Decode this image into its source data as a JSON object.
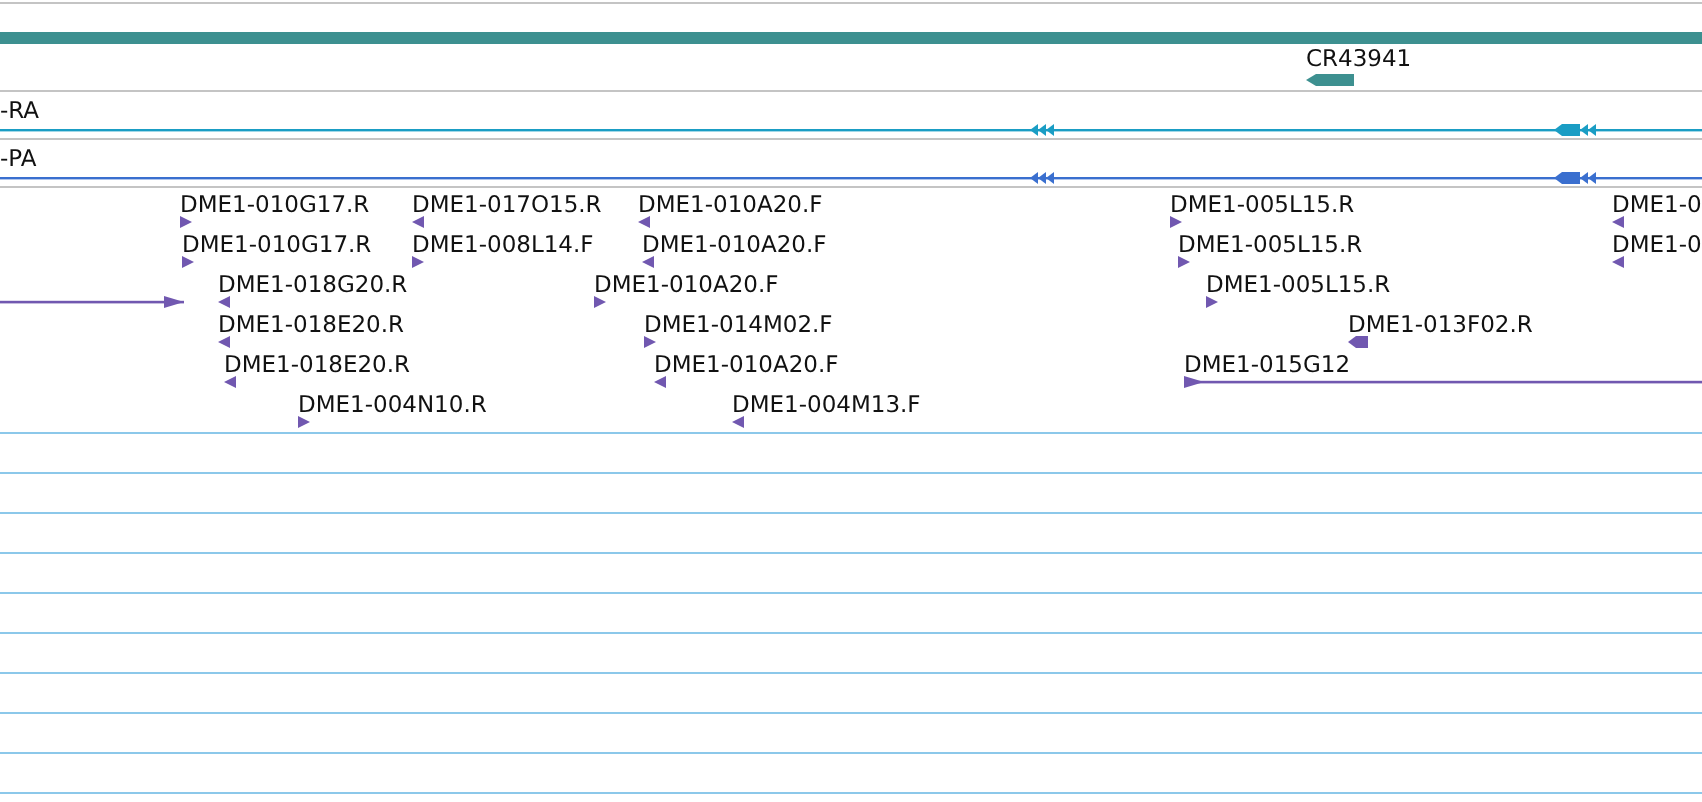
{
  "gene_track": {
    "features": [
      {
        "label": "CR43941",
        "reverse": true
      }
    ]
  },
  "transcript_track": {
    "label": "-RA",
    "reverse": true
  },
  "protein_track": {
    "label": "-PA",
    "reverse": true
  },
  "clone_track": {
    "features": [
      {
        "kind": "marker",
        "label": "DME1-010G17.R",
        "reverse": false
      },
      {
        "kind": "marker",
        "label": "DME1-017O15.R",
        "reverse": true
      },
      {
        "kind": "marker",
        "label": "DME1-010A20.F",
        "reverse": true
      },
      {
        "kind": "marker",
        "label": "DME1-005L15.R",
        "reverse": false
      },
      {
        "kind": "marker",
        "label": "DME1-0",
        "reverse": true
      },
      {
        "kind": "marker",
        "label": "DME1-010G17.R",
        "reverse": false
      },
      {
        "kind": "marker",
        "label": "DME1-008L14.F",
        "reverse": false
      },
      {
        "kind": "marker",
        "label": "DME1-010A20.F",
        "reverse": true
      },
      {
        "kind": "marker",
        "label": "DME1-005L15.R",
        "reverse": false
      },
      {
        "kind": "marker",
        "label": "DME1-0",
        "reverse": true
      },
      {
        "kind": "span",
        "reverse": false
      },
      {
        "kind": "marker",
        "label": "DME1-018G20.R",
        "reverse": true
      },
      {
        "kind": "marker",
        "label": "DME1-010A20.F",
        "reverse": false
      },
      {
        "kind": "marker",
        "label": "DME1-005L15.R",
        "reverse": false
      },
      {
        "kind": "marker",
        "label": "DME1-018E20.R",
        "reverse": true
      },
      {
        "kind": "marker",
        "label": "DME1-014M02.F",
        "reverse": false
      },
      {
        "kind": "block",
        "label": "DME1-013F02.R",
        "reverse": true
      },
      {
        "kind": "marker",
        "label": "DME1-018E20.R",
        "reverse": true
      },
      {
        "kind": "marker",
        "label": "DME1-010A20.F",
        "reverse": true
      },
      {
        "kind": "span",
        "label": "DME1-015G12",
        "reverse": false
      },
      {
        "kind": "marker",
        "label": "DME1-004N10.R",
        "reverse": false
      },
      {
        "kind": "marker",
        "label": "DME1-004M13.F",
        "reverse": true
      }
    ]
  }
}
